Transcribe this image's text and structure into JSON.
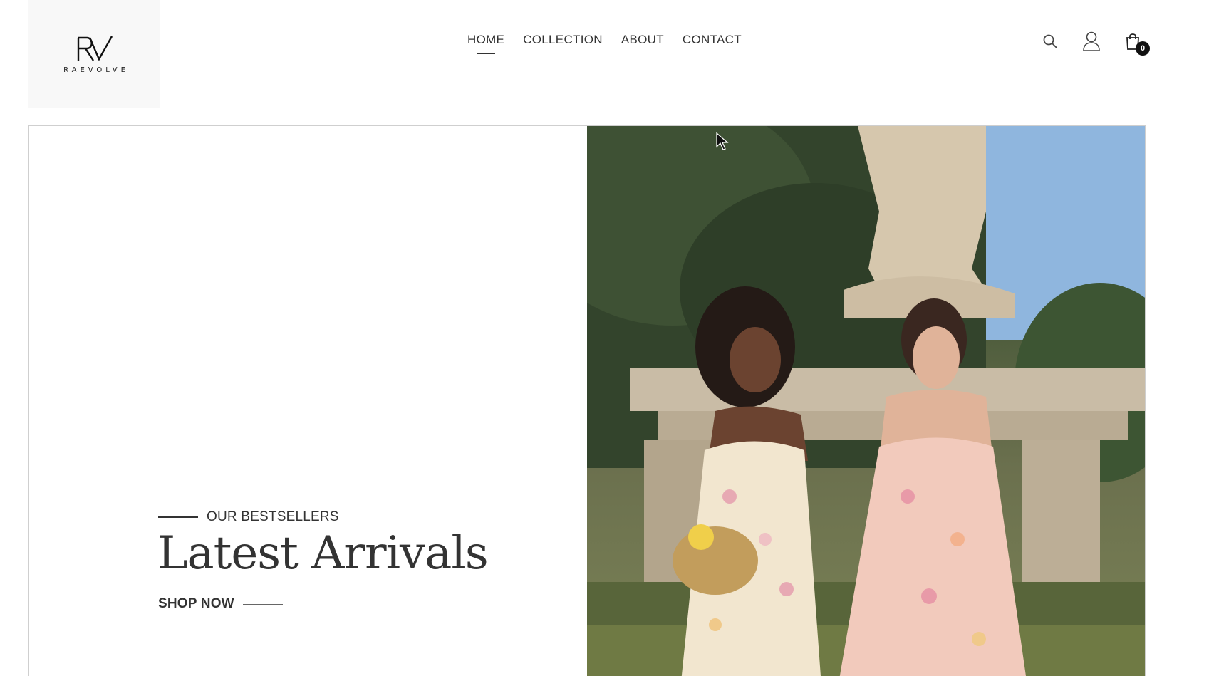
{
  "brand": {
    "monogram": "RV",
    "wordmark": "RAEVOLVE"
  },
  "nav": {
    "items": [
      {
        "label": "HOME",
        "active": true
      },
      {
        "label": "COLLECTION",
        "active": false
      },
      {
        "label": "ABOUT",
        "active": false
      },
      {
        "label": "CONTACT",
        "active": false
      }
    ]
  },
  "header_icons": {
    "search": "search-icon",
    "account": "user-icon",
    "cart": "shopping-bag-icon",
    "cart_count": "0"
  },
  "hero": {
    "eyebrow": "OUR BESTSELLERS",
    "title": "Latest Arrivals",
    "cta": "SHOP NOW"
  }
}
